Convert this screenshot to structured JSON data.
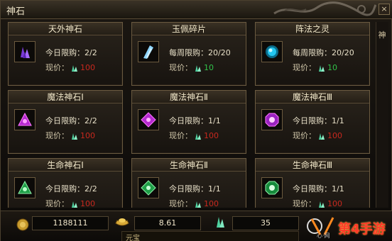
{
  "window": {
    "title": "神石",
    "close_label": "×"
  },
  "cards": [
    {
      "name": "天外神石",
      "limit": "今日限购：2/2",
      "price_label": "现价：",
      "price": "100",
      "price_color": "#c8281e",
      "gem": "purple-crystal"
    },
    {
      "name": "玉佩碎片",
      "limit": "每周限购：20/20",
      "price_label": "现价：",
      "price": "10",
      "price_color": "#31c24a",
      "gem": "blue-shard"
    },
    {
      "name": "阵法之灵",
      "limit": "每周限购：20/20",
      "price_label": "现价：",
      "price": "10",
      "price_color": "#31c24a",
      "gem": "cyan-orb"
    },
    {
      "name": "魔法神石Ⅰ",
      "limit": "今日限购：2/2",
      "price_label": "现价：",
      "price": "100",
      "price_color": "#c8281e",
      "gem": "magenta-triangle"
    },
    {
      "name": "魔法神石Ⅱ",
      "limit": "今日限购：1/1",
      "price_label": "现价：",
      "price": "100",
      "price_color": "#c8281e",
      "gem": "magenta-diamond"
    },
    {
      "name": "魔法神石Ⅲ",
      "limit": "今日限购：1/1",
      "price_label": "现价：",
      "price": "100",
      "price_color": "#c8281e",
      "gem": "magenta-octagon"
    },
    {
      "name": "生命神石Ⅰ",
      "limit": "今日限购：2/2",
      "price_label": "现价：",
      "price": "100",
      "price_color": "#c8281e",
      "gem": "green-triangle"
    },
    {
      "name": "生命神石Ⅱ",
      "limit": "今日限购：1/1",
      "price_label": "现价：",
      "price": "100",
      "price_color": "#c8281e",
      "gem": "green-diamond"
    },
    {
      "name": "生命神石Ⅲ",
      "limit": "今日限购：1/1",
      "price_label": "现价：",
      "price": "100",
      "price_color": "#c8281e",
      "gem": "green-octagon"
    }
  ],
  "currency": {
    "gold": "1188111",
    "ingot": "8.61",
    "crystal": "35",
    "yuanbao_label": "元宝"
  },
  "side": {
    "label": "神"
  },
  "watermark": {
    "text": "第4手游",
    "sub": "心·网"
  }
}
